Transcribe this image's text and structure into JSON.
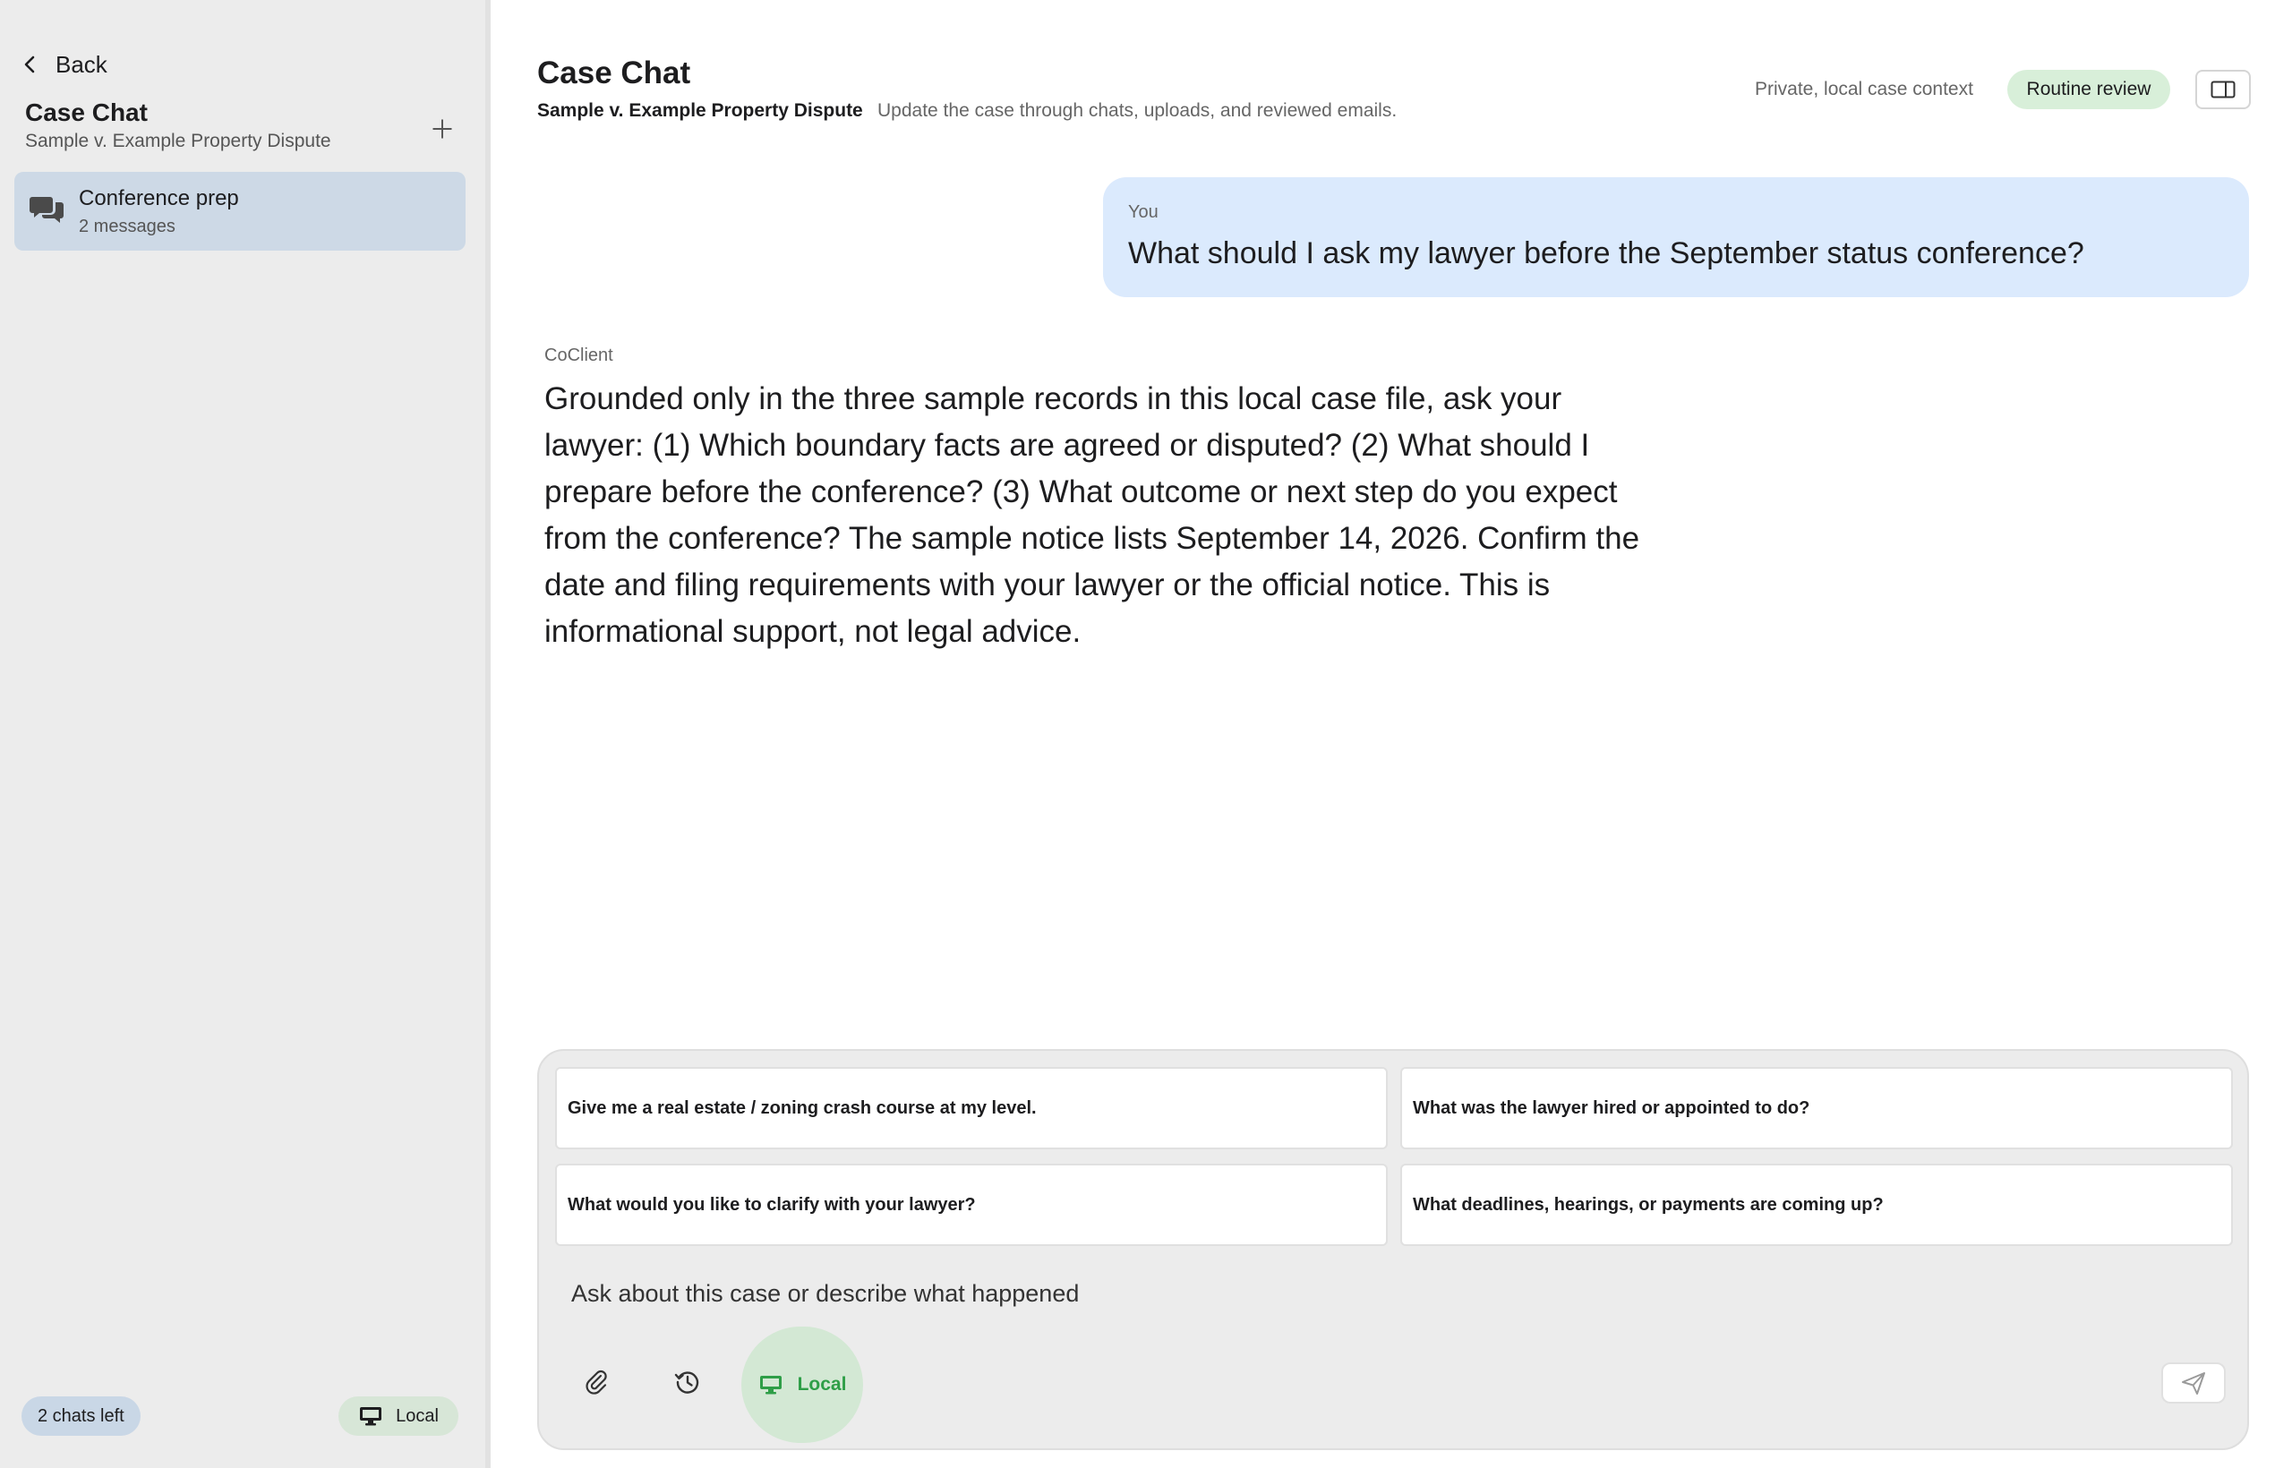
{
  "sidebar": {
    "back_label": "Back",
    "title": "Case Chat",
    "subtitle": "Sample v. Example Property Dispute",
    "chats": [
      {
        "title": "Conference prep",
        "subtitle": "2 messages"
      }
    ],
    "chats_left": "2 chats left",
    "mode_label": "Local"
  },
  "header": {
    "title": "Case Chat",
    "case_name": "Sample v. Example Property Dispute",
    "description": "Update the case through chats, uploads, and reviewed emails.",
    "context_label": "Private, local case context",
    "review_badge": "Routine review"
  },
  "messages": [
    {
      "sender": "You",
      "text": "What should I ask my lawyer before the September status conference?"
    },
    {
      "sender": "CoClient",
      "text": "Grounded only in the three sample records in this local case file, ask your lawyer: (1) Which boundary facts are agreed or disputed? (2) What should I prepare before the conference? (3) What outcome or next step do you expect from the conference? The sample notice lists September 14, 2026. Confirm the date and filing requirements with your lawyer or the official notice. This is informational support, not legal advice."
    }
  ],
  "composer": {
    "suggestions": [
      "Give me a real estate / zoning crash course at my level.",
      "What was the lawyer hired or appointed to do?",
      "What would you like to clarify with your lawyer?",
      "What deadlines, hearings, or payments are coming up?"
    ],
    "placeholder": "Ask about this case or describe what happened",
    "value": "",
    "mode_label": "Local"
  },
  "colors": {
    "sidebar_bg": "#ececec",
    "selected_chat_bg": "#cdd9e6",
    "user_bubble_bg": "#dbeafd",
    "badge_green_bg": "#d8efd9",
    "local_accent": "#2e9e47"
  },
  "icons": {
    "back": "chevron-left-icon",
    "add": "plus-icon",
    "chat": "chat-bubbles-icon",
    "monitor": "monitor-icon",
    "panel": "sidebar-panel-icon",
    "attach": "paperclip-icon",
    "history": "history-icon",
    "send": "send-icon"
  }
}
